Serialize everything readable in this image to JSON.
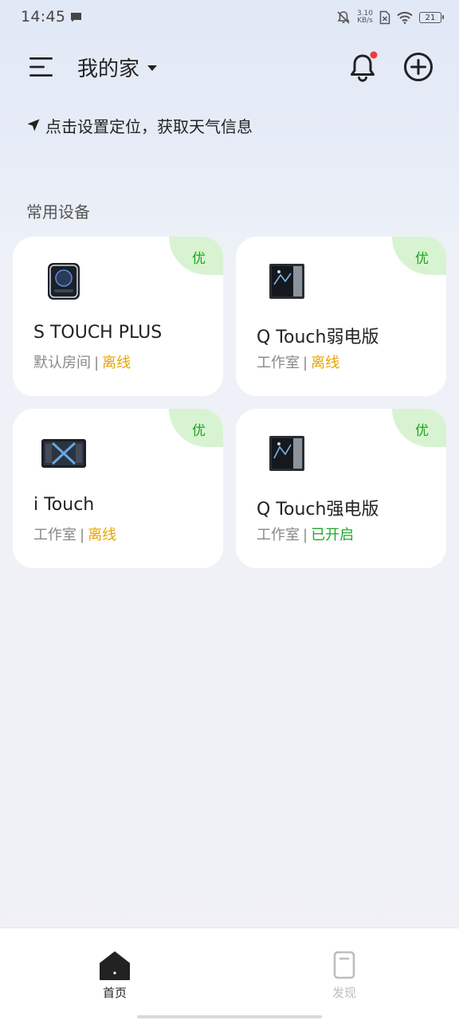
{
  "status_bar": {
    "time": "14:45",
    "net_speed_value": "3.10",
    "net_speed_unit": "KB/s",
    "battery": "21"
  },
  "header": {
    "home_name": "我的家"
  },
  "location": {
    "prompt": "点击设置定位，获取天气信息"
  },
  "section": {
    "title": "常用设备"
  },
  "devices": [
    {
      "name": "S TOUCH PLUS",
      "room": "默认房间",
      "separator": "|",
      "status": "离线",
      "badge": "优",
      "status_color": "#e6a400"
    },
    {
      "name": "Q Touch弱电版",
      "room": "工作室",
      "separator": "|",
      "status": "离线",
      "badge": "优",
      "status_color": "#e6a400"
    },
    {
      "name": "i Touch",
      "room": "工作室",
      "separator": "|",
      "status": "离线",
      "badge": "优",
      "status_color": "#e6a400"
    },
    {
      "name": "Q Touch强电版",
      "room": "工作室",
      "separator": "|",
      "status": "已开启",
      "badge": "优",
      "status_color": "#21a82b"
    }
  ],
  "bottom_nav": {
    "items": [
      {
        "label": "首页",
        "icon": "home-icon",
        "active": true
      },
      {
        "label": "发现",
        "icon": "discover-icon",
        "active": false
      }
    ]
  },
  "colors": {
    "badge_bg": "#d8f3d2",
    "badge_text": "#1aa51a",
    "offline": "#e6a400",
    "online": "#21a82b",
    "notification_dot": "#ee3b3b"
  }
}
